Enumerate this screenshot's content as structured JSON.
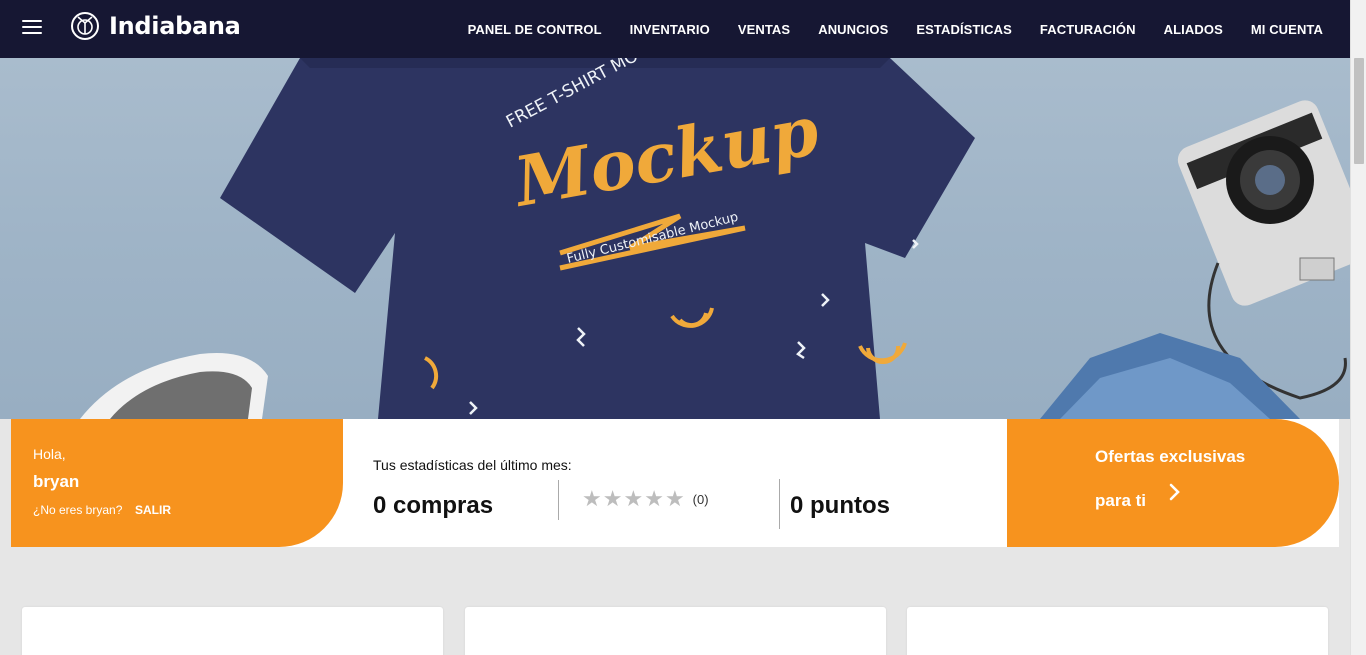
{
  "brand": {
    "name": "Indiabana"
  },
  "nav": {
    "items": [
      "PANEL DE CONTROL",
      "INVENTARIO",
      "VENTAS",
      "ANUNCIOS",
      "ESTADÍSTICAS",
      "FACTURACIÓN",
      "ALIADOS",
      "MI CUENTA"
    ]
  },
  "hero": {
    "arc_text": "FREE T-SHIRT MOCKUP SCENE",
    "title": "Mockup",
    "subtitle": "Fully Customisable Mockup"
  },
  "user": {
    "greeting": "Hola,",
    "name": "bryan",
    "not_you": "¿No eres bryan?",
    "logout": "SALIR"
  },
  "stats": {
    "label": "Tus estadísticas del último mes:",
    "purchases": "0 compras",
    "rating": 0,
    "rating_count": "(0)",
    "points": "0 puntos"
  },
  "offers": {
    "line1": "Ofertas exclusivas",
    "line2": "para ti"
  },
  "colors": {
    "nav_bg": "#161733",
    "accent": "#f7931e",
    "page_bg": "#e6e6e6",
    "shirt": "#2d3461",
    "print": "#f0a93a"
  }
}
